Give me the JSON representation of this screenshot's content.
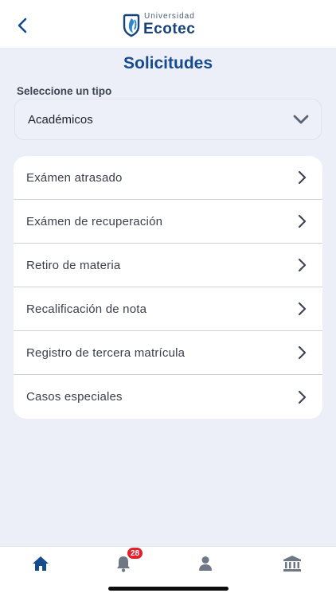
{
  "header": {
    "back_icon": "chevron-left-icon",
    "logo_small": "Universidad",
    "logo_big": "Ecotec"
  },
  "page": {
    "title": "Solicitudes"
  },
  "type_selector": {
    "label": "Seleccione un tipo",
    "value": "Académicos",
    "icon": "chevron-down-icon"
  },
  "requests": [
    {
      "label": "Exámen atrasado"
    },
    {
      "label": "Exámen de recuperación"
    },
    {
      "label": "Retiro de materia"
    },
    {
      "label": "Recalificación de nota"
    },
    {
      "label": "Registro de tercera matrícula"
    },
    {
      "label": "Casos especiales"
    }
  ],
  "tabbar": {
    "notification_count": "28",
    "tabs": [
      {
        "icon": "home-icon",
        "active": true
      },
      {
        "icon": "bell-icon",
        "active": false
      },
      {
        "icon": "user-icon",
        "active": false
      },
      {
        "icon": "bank-icon",
        "active": false
      }
    ]
  },
  "colors": {
    "primary": "#164b8c",
    "background": "#eceef8",
    "badge": "#e3202b",
    "inactive_icon": "#707784"
  }
}
